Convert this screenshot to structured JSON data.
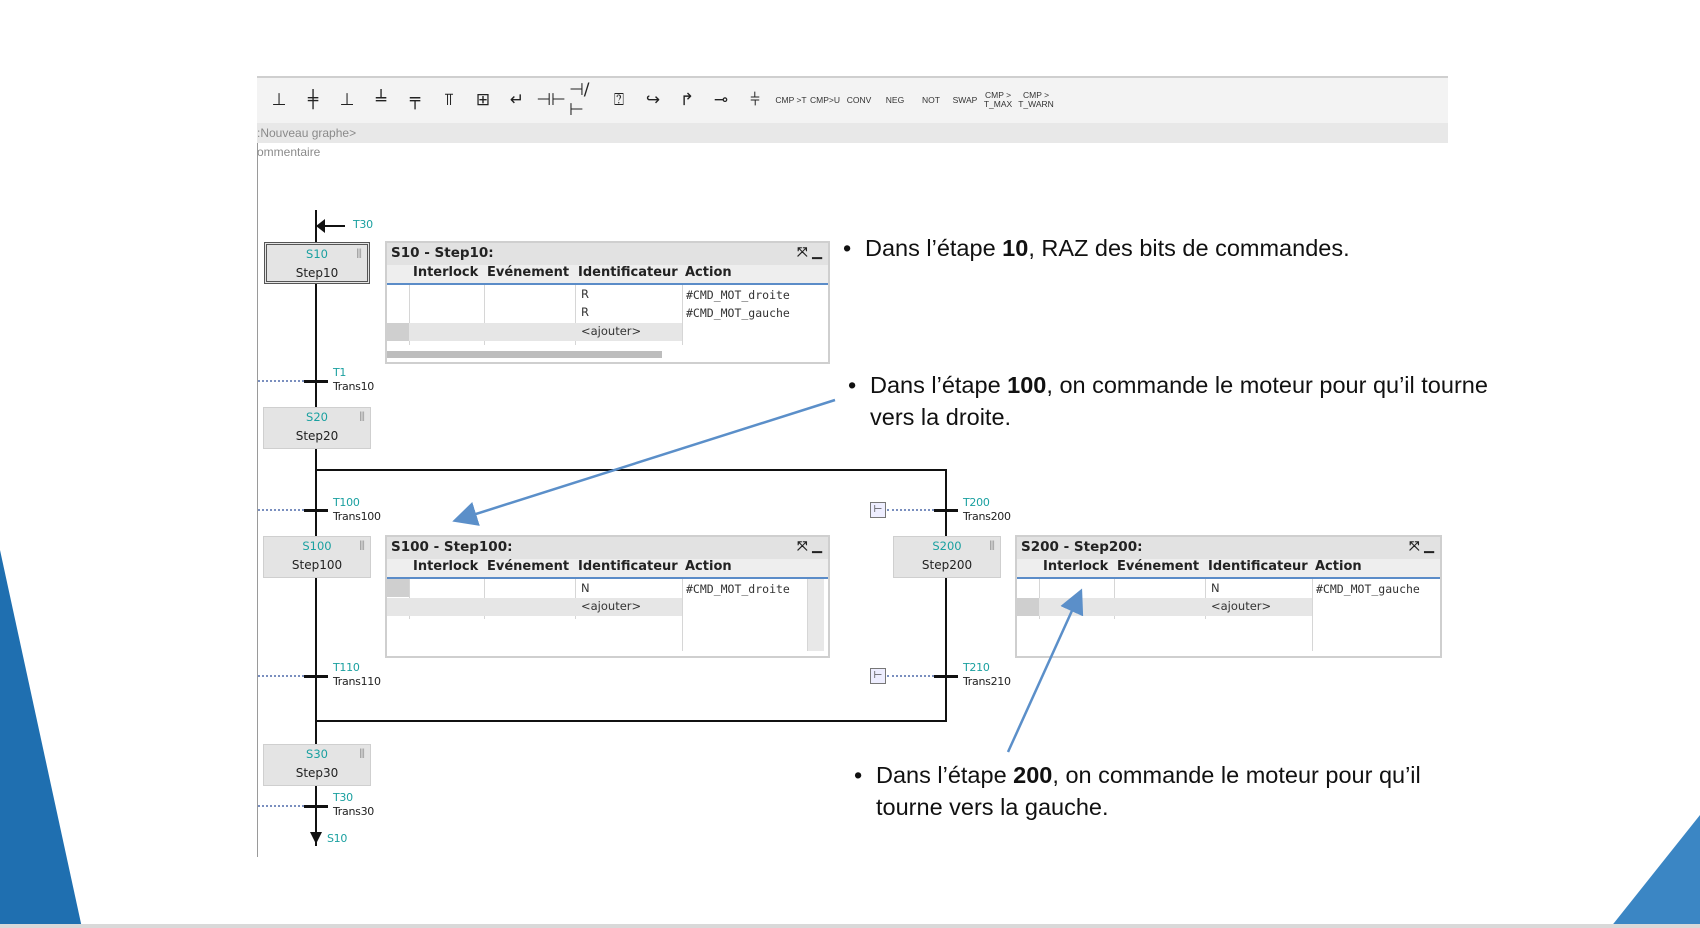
{
  "toolbar": {
    "text_buttons": [
      "CMP >T",
      "CMP>U",
      "CONV",
      "NEG",
      "NOT",
      "SWAP",
      "CMP > T_MAX",
      "CMP > T_WARN"
    ]
  },
  "editor": {
    "graph_tab": ":Nouveau graphe>",
    "comment": "ommentaire"
  },
  "graph": {
    "top_jump": "T30",
    "bottom_jump": "S10",
    "steps": [
      {
        "num": "S10",
        "name": "Step10"
      },
      {
        "num": "S20",
        "name": "Step20"
      },
      {
        "num": "S100",
        "name": "Step100"
      },
      {
        "num": "S200",
        "name": "Step200"
      },
      {
        "num": "S30",
        "name": "Step30"
      }
    ],
    "transitions": [
      {
        "num": "T1",
        "name": "Trans10"
      },
      {
        "num": "T100",
        "name": "Trans100"
      },
      {
        "num": "T200",
        "name": "Trans200"
      },
      {
        "num": "T110",
        "name": "Trans110"
      },
      {
        "num": "T210",
        "name": "Trans210"
      },
      {
        "num": "T30",
        "name": "Trans30"
      }
    ]
  },
  "tables": {
    "columns": [
      "Interlock",
      "Evénement",
      "Identificateur",
      "Action"
    ],
    "add_placeholder": "<ajouter>",
    "s10": {
      "title": "S10 - Step10:",
      "rows": [
        {
          "qualifier": "R",
          "action": "#CMD_MOT_droite"
        },
        {
          "qualifier": "R",
          "action": "#CMD_MOT_gauche"
        }
      ]
    },
    "s100": {
      "title": "S100 - Step100:",
      "rows": [
        {
          "qualifier": "N",
          "action": "#CMD_MOT_droite"
        }
      ]
    },
    "s200": {
      "title": "S200 - Step200:",
      "rows": [
        {
          "qualifier": "N",
          "action": "#CMD_MOT_gauche"
        }
      ]
    }
  },
  "notes": {
    "n1": {
      "pre": "Dans l’étape ",
      "bold": "10",
      "post": ", RAZ des bits de commandes."
    },
    "n2": {
      "pre": "Dans l’étape ",
      "bold": "100",
      "post": ", on commande le moteur pour qu’il tourne",
      "line2": "vers la droite."
    },
    "n3": {
      "pre": "Dans l’étape ",
      "bold": "200",
      "post": ", on commande le moteur pour qu’il",
      "line2": "tourne vers la gauche."
    }
  },
  "colors": {
    "accent": "#1f6fb0",
    "arrow": "#5b8fc9",
    "step_number": "#1aa0a0"
  }
}
